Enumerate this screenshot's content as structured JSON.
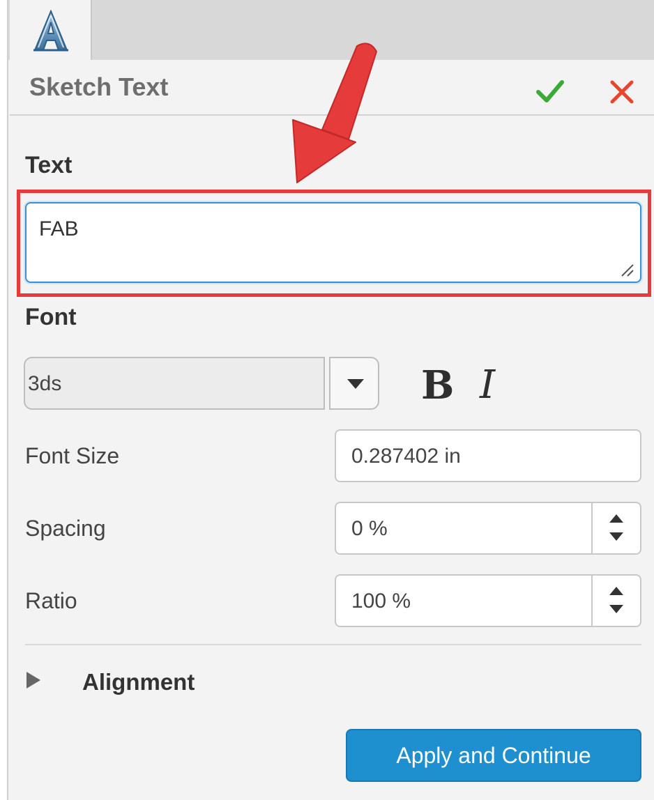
{
  "panel": {
    "title": "Sketch Text",
    "tab_icon": "sketch-text-icon",
    "confirm_icon": "checkmark-icon",
    "cancel_icon": "close-icon"
  },
  "text_section": {
    "label": "Text",
    "value": "FAB"
  },
  "font_section": {
    "label": "Font",
    "font_name": "3ds",
    "bold_label": "B",
    "italic_label": "I"
  },
  "fields": {
    "font_size": {
      "label": "Font Size",
      "value": "0.287402 in"
    },
    "spacing": {
      "label": "Spacing",
      "value": "0 %"
    },
    "ratio": {
      "label": "Ratio",
      "value": "100 %"
    }
  },
  "alignment": {
    "label": "Alignment"
  },
  "apply_button": {
    "label": "Apply and Continue"
  },
  "colors": {
    "accent_blue": "#1e8fcf",
    "confirm_green": "#3aa935",
    "cancel_red": "#e8452c",
    "annotation_red": "#e53b3b"
  }
}
